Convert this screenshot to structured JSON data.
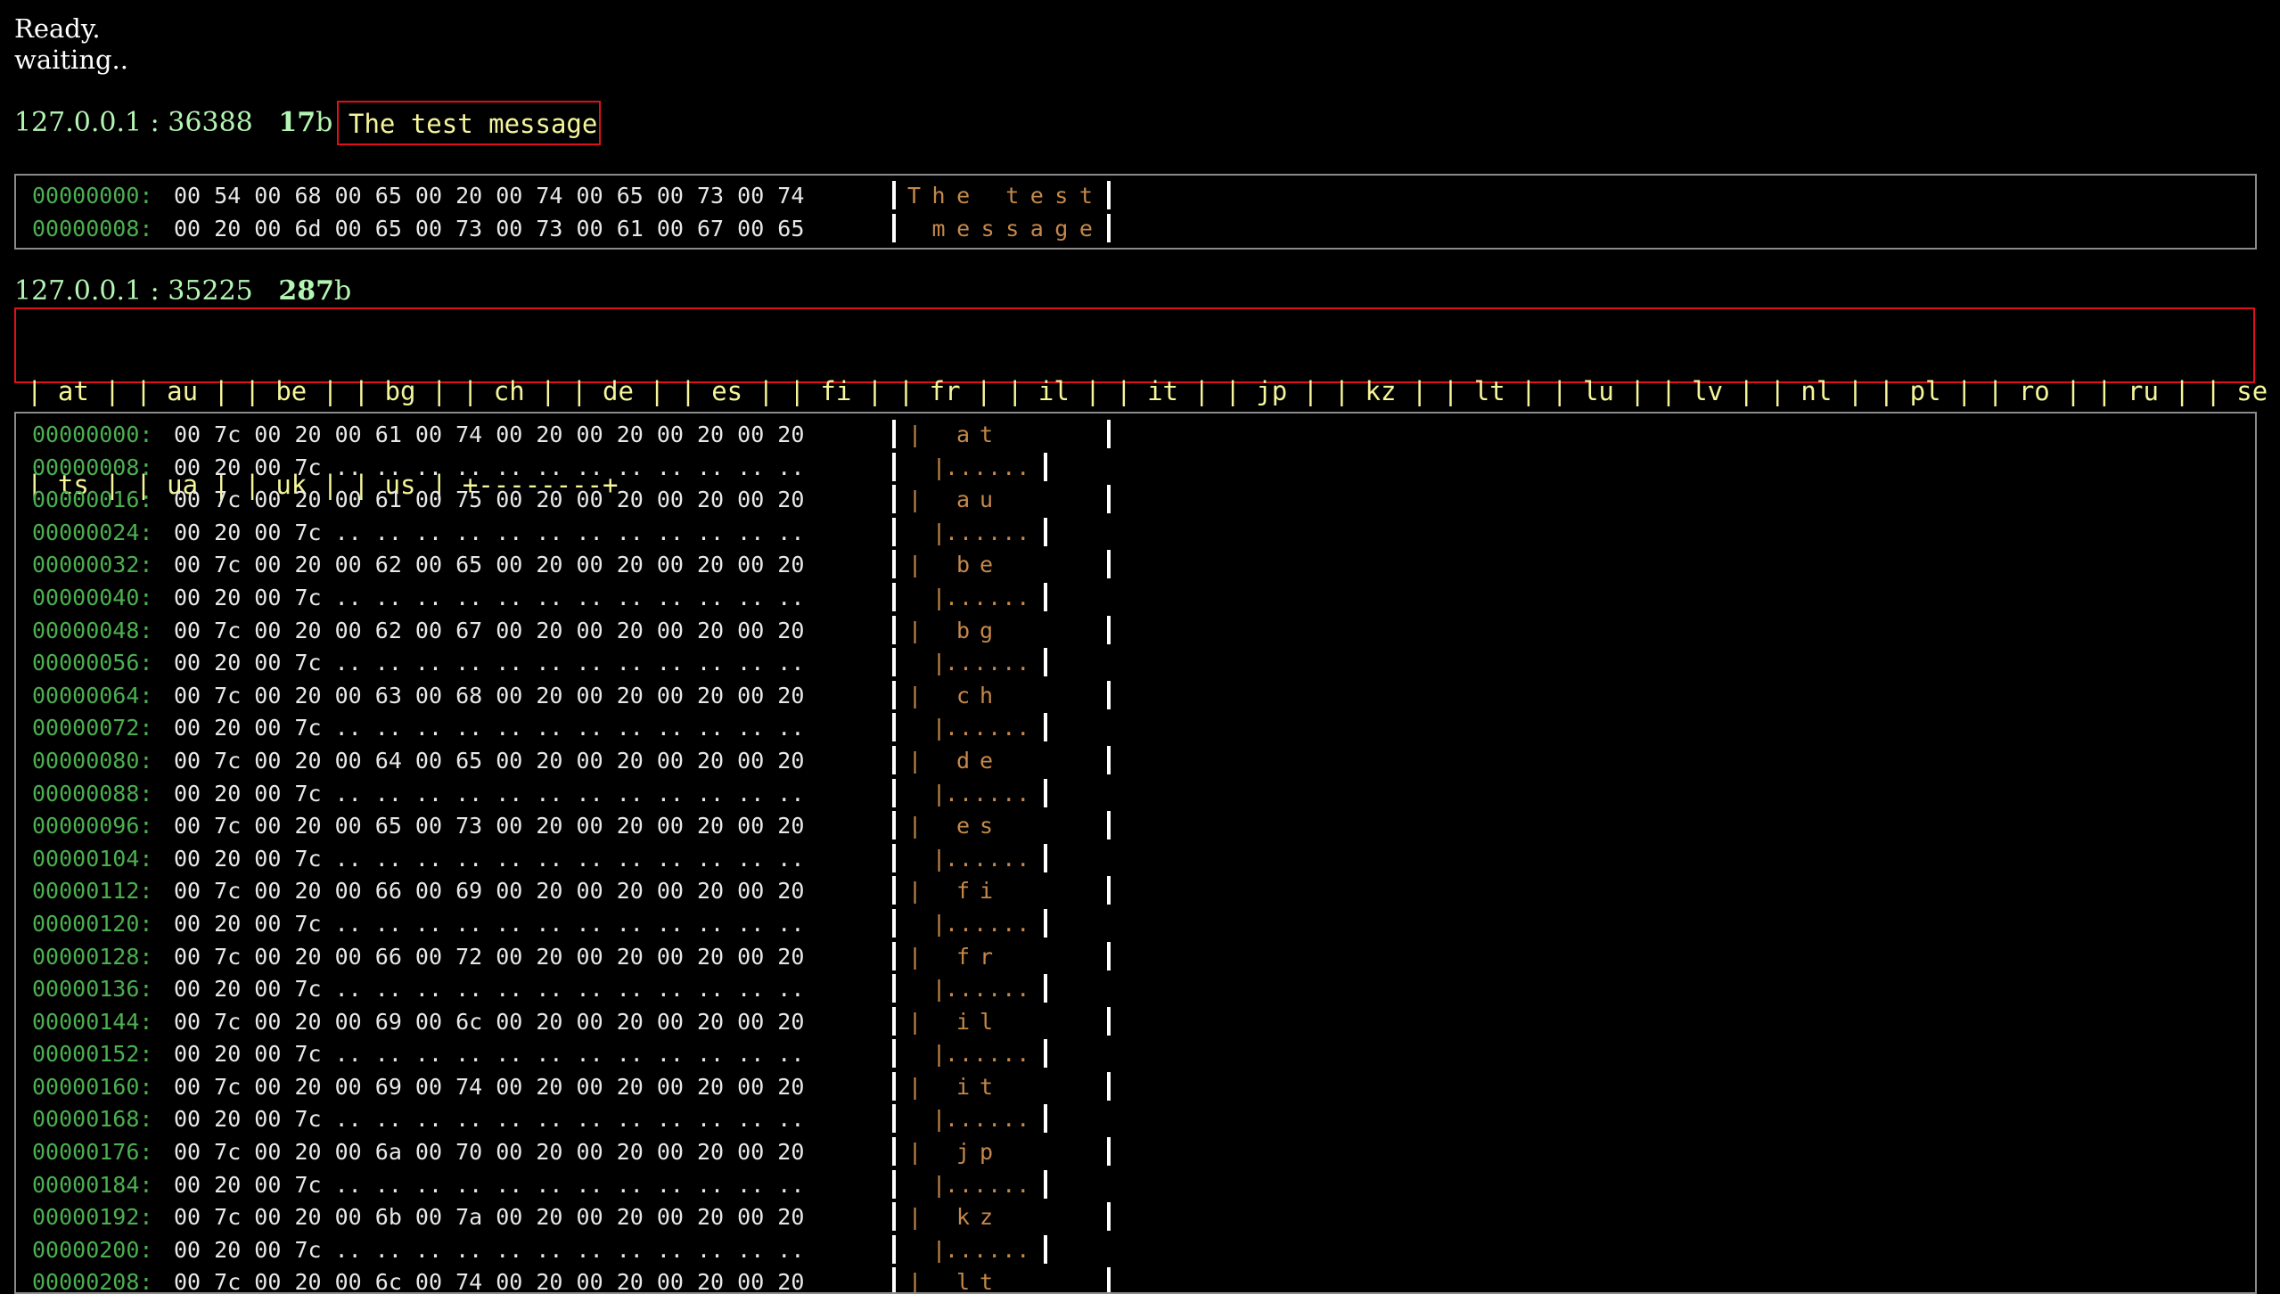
{
  "status": [
    "Ready.",
    "waiting.."
  ],
  "messages": [
    {
      "addr": "127.0.0.1 : 36388",
      "size": "17",
      "unit": "b",
      "text": "The test message",
      "dump": [
        {
          "offset": "00000000:",
          "hex": "00 54 00 68 00 65 00 20 00 74 00 65 00 73 00 74",
          "ascii": "The test",
          "mode": "full"
        },
        {
          "offset": "00000008:",
          "hex": "00 20 00 6d 00 65 00 73 00 73 00 61 00 67 00 65",
          "ascii": " message",
          "mode": "full"
        }
      ]
    },
    {
      "addr": "127.0.0.1 : 35225",
      "size": "287",
      "unit": "b",
      "text_lines": [
        "| at | | au | | be | | bg | | ch | | de | | es | | fi | | fr | | il | | it | | jp | | kz | | lt | | lu | | lv | | nl | | pl | | ro | | ru | | se |",
        "| ts | | ua | | uk | | us | +--------+"
      ],
      "dump": [
        {
          "offset": "00000000:",
          "hex": "00 7c 00 20 00 61 00 74 00 20 00 20 00 20 00 20",
          "ascii": "at",
          "mode": "head"
        },
        {
          "offset": "00000008:",
          "hex": "00 20 00 7c .. .. .. .. .. .. .. .. .. .. .. ..",
          "ascii": "......",
          "mode": "tail"
        },
        {
          "offset": "00000016:",
          "hex": "00 7c 00 20 00 61 00 75 00 20 00 20 00 20 00 20",
          "ascii": "au",
          "mode": "head"
        },
        {
          "offset": "00000024:",
          "hex": "00 20 00 7c .. .. .. .. .. .. .. .. .. .. .. ..",
          "ascii": "......",
          "mode": "tail"
        },
        {
          "offset": "00000032:",
          "hex": "00 7c 00 20 00 62 00 65 00 20 00 20 00 20 00 20",
          "ascii": "be",
          "mode": "head"
        },
        {
          "offset": "00000040:",
          "hex": "00 20 00 7c .. .. .. .. .. .. .. .. .. .. .. ..",
          "ascii": "......",
          "mode": "tail"
        },
        {
          "offset": "00000048:",
          "hex": "00 7c 00 20 00 62 00 67 00 20 00 20 00 20 00 20",
          "ascii": "bg",
          "mode": "head"
        },
        {
          "offset": "00000056:",
          "hex": "00 20 00 7c .. .. .. .. .. .. .. .. .. .. .. ..",
          "ascii": "......",
          "mode": "tail"
        },
        {
          "offset": "00000064:",
          "hex": "00 7c 00 20 00 63 00 68 00 20 00 20 00 20 00 20",
          "ascii": "ch",
          "mode": "head"
        },
        {
          "offset": "00000072:",
          "hex": "00 20 00 7c .. .. .. .. .. .. .. .. .. .. .. ..",
          "ascii": "......",
          "mode": "tail"
        },
        {
          "offset": "00000080:",
          "hex": "00 7c 00 20 00 64 00 65 00 20 00 20 00 20 00 20",
          "ascii": "de",
          "mode": "head"
        },
        {
          "offset": "00000088:",
          "hex": "00 20 00 7c .. .. .. .. .. .. .. .. .. .. .. ..",
          "ascii": "......",
          "mode": "tail"
        },
        {
          "offset": "00000096:",
          "hex": "00 7c 00 20 00 65 00 73 00 20 00 20 00 20 00 20",
          "ascii": "es",
          "mode": "head"
        },
        {
          "offset": "00000104:",
          "hex": "00 20 00 7c .. .. .. .. .. .. .. .. .. .. .. ..",
          "ascii": "......",
          "mode": "tail"
        },
        {
          "offset": "00000112:",
          "hex": "00 7c 00 20 00 66 00 69 00 20 00 20 00 20 00 20",
          "ascii": "fi",
          "mode": "head"
        },
        {
          "offset": "00000120:",
          "hex": "00 20 00 7c .. .. .. .. .. .. .. .. .. .. .. ..",
          "ascii": "......",
          "mode": "tail"
        },
        {
          "offset": "00000128:",
          "hex": "00 7c 00 20 00 66 00 72 00 20 00 20 00 20 00 20",
          "ascii": "fr",
          "mode": "head"
        },
        {
          "offset": "00000136:",
          "hex": "00 20 00 7c .. .. .. .. .. .. .. .. .. .. .. ..",
          "ascii": "......",
          "mode": "tail"
        },
        {
          "offset": "00000144:",
          "hex": "00 7c 00 20 00 69 00 6c 00 20 00 20 00 20 00 20",
          "ascii": "il",
          "mode": "head"
        },
        {
          "offset": "00000152:",
          "hex": "00 20 00 7c .. .. .. .. .. .. .. .. .. .. .. ..",
          "ascii": "......",
          "mode": "tail"
        },
        {
          "offset": "00000160:",
          "hex": "00 7c 00 20 00 69 00 74 00 20 00 20 00 20 00 20",
          "ascii": "it",
          "mode": "head"
        },
        {
          "offset": "00000168:",
          "hex": "00 20 00 7c .. .. .. .. .. .. .. .. .. .. .. ..",
          "ascii": "......",
          "mode": "tail"
        },
        {
          "offset": "00000176:",
          "hex": "00 7c 00 20 00 6a 00 70 00 20 00 20 00 20 00 20",
          "ascii": "jp",
          "mode": "head"
        },
        {
          "offset": "00000184:",
          "hex": "00 20 00 7c .. .. .. .. .. .. .. .. .. .. .. ..",
          "ascii": "......",
          "mode": "tail"
        },
        {
          "offset": "00000192:",
          "hex": "00 7c 00 20 00 6b 00 7a 00 20 00 20 00 20 00 20",
          "ascii": "kz",
          "mode": "head"
        },
        {
          "offset": "00000200:",
          "hex": "00 20 00 7c .. .. .. .. .. .. .. .. .. .. .. ..",
          "ascii": "......",
          "mode": "tail"
        },
        {
          "offset": "00000208:",
          "hex": "00 7c 00 20 00 6c 00 74 00 20 00 20 00 20 00 20",
          "ascii": "lt",
          "mode": "head"
        }
      ]
    }
  ]
}
